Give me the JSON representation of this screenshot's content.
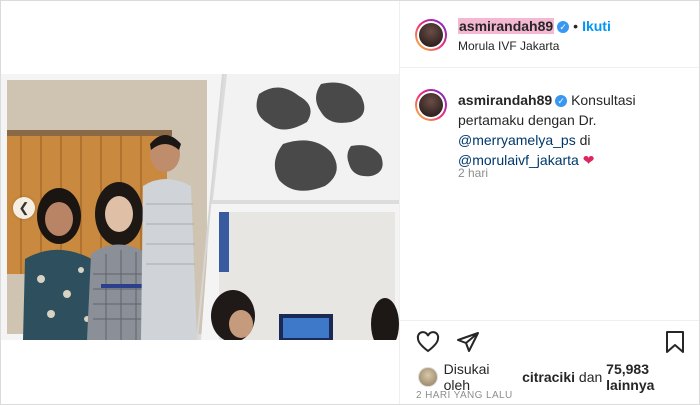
{
  "header": {
    "username": "asmirandah89",
    "follow_label": "Ikuti",
    "location": "Morula IVF Jakarta"
  },
  "caption": {
    "username": "asmirandah89",
    "text_1": "Konsultasi pertamaku dengan Dr.",
    "mention_1": "@merryamelya_ps",
    "text_2": "di",
    "mention_2": "@morulaivf_jakarta",
    "time": "2 hari"
  },
  "engagement": {
    "likes_prefix": "Disukai oleh",
    "liked_by": "citraciki",
    "likes_and": "dan",
    "likes_count": "75,983 lainnya",
    "posted": "2 HARI YANG LALU"
  },
  "icons": [
    "heart-icon",
    "comment-icon",
    "share-icon",
    "bookmark-icon",
    "verified-icon",
    "chevron-left-icon"
  ],
  "colors": {
    "link": "#0095f6",
    "verified": "#3897f0",
    "mention": "#00376b",
    "heart_emoji": "#e0245e"
  }
}
